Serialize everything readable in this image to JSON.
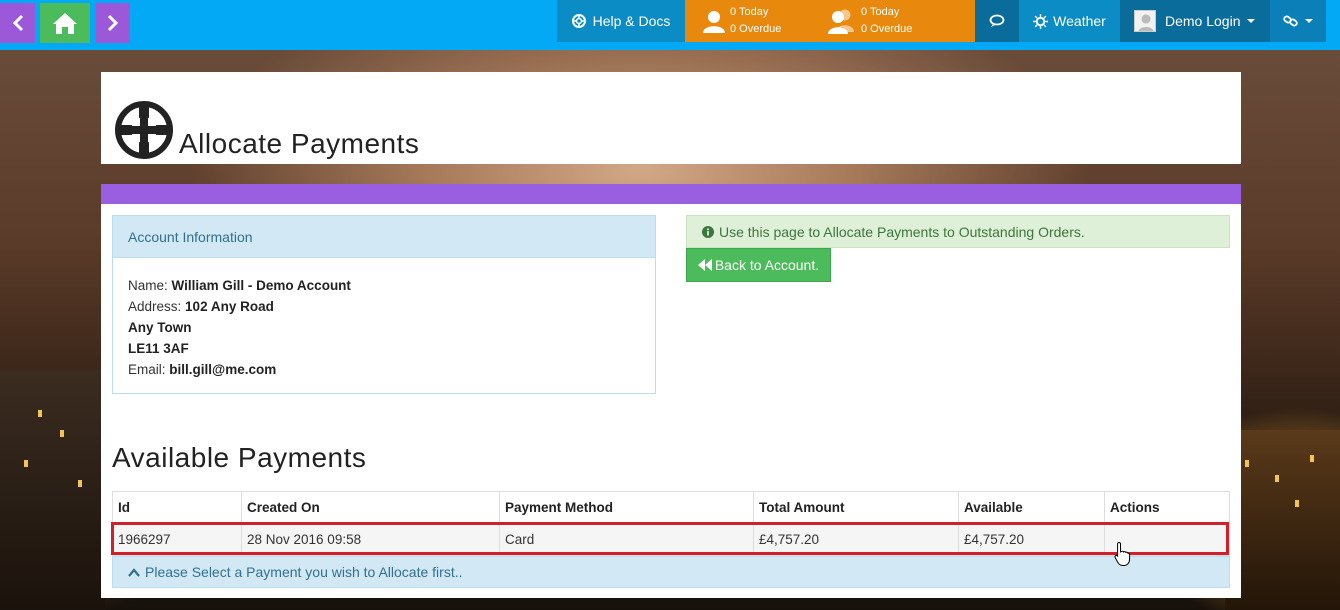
{
  "navbar": {
    "back_icon": "chevron-left-icon",
    "home_icon": "home-icon",
    "forward_icon": "chevron-right-icon",
    "help_label": "Help & Docs",
    "tasks_single": {
      "today": "0 Today",
      "overdue": "0 Overdue"
    },
    "tasks_group": {
      "today": "0 Today",
      "overdue": "0 Overdue"
    },
    "chat_icon": "chat-icon",
    "weather_label": "Weather",
    "user_label": "Demo Login",
    "links_icon": "link-icon"
  },
  "page": {
    "title": "Allocate Payments",
    "title_icon": "crosshair-circle-icon"
  },
  "account": {
    "heading": "Account Information",
    "name_label": "Name:",
    "name": "William Gill - Demo Account",
    "address_label": "Address:",
    "address_line1": "102 Any Road",
    "address_line2": "Any Town",
    "address_line3": "LE11 3AF",
    "email_label": "Email:",
    "email": "bill.gill@me.com"
  },
  "info": {
    "message": "Use this page to Allocate Payments to Outstanding Orders.",
    "back_button": "Back to Account."
  },
  "payments": {
    "title": "Available Payments",
    "columns": [
      "Id",
      "Created On",
      "Payment Method",
      "Total Amount",
      "Available",
      "Actions"
    ],
    "rows": [
      {
        "id": "1966297",
        "created_on": "28 Nov 2016 09:58",
        "method": "Card",
        "total": "£4,757.20",
        "available": "£4,757.20",
        "actions": ""
      }
    ],
    "select_message": "Please Select a Payment you wish to Allocate first.."
  },
  "colors": {
    "navbar": "#03a9f4",
    "purple": "#9b59d9",
    "green": "#4cbb5c",
    "orange": "#e8890e",
    "highlight": "#d0202a"
  }
}
